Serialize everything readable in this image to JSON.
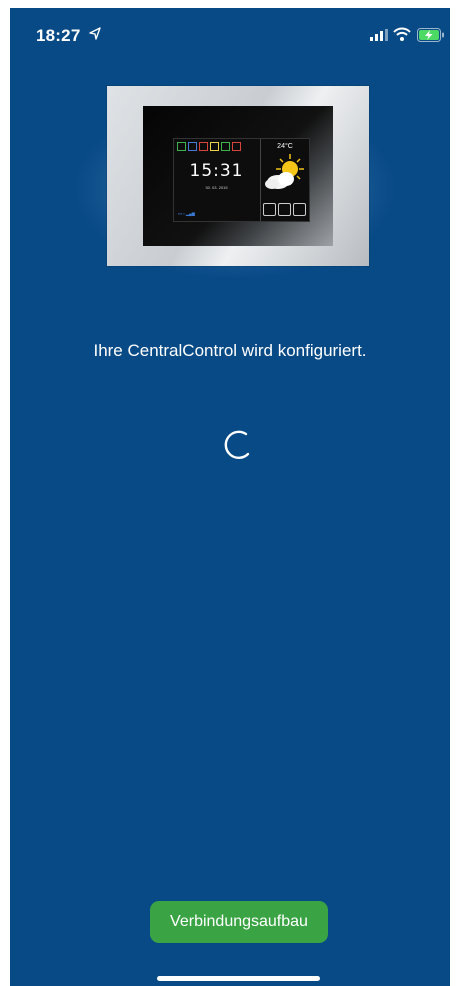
{
  "status_bar": {
    "time": "18:27",
    "location_icon": "location-arrow-icon",
    "signal_icon": "cellular-signal-icon",
    "wifi_icon": "wifi-icon",
    "battery_icon": "battery-charging-icon"
  },
  "device_image": {
    "time": "15:31",
    "date": "30. 03. 2015",
    "temperature": "24°C",
    "weather_icon": "sun-cloud-icon"
  },
  "message": "Ihre CentralControl wird konfiguriert.",
  "spinner_icon": "loading-spinner-icon",
  "button": {
    "label": "Verbindungsaufbau"
  },
  "colors": {
    "background": "#084a86",
    "button": "#3aa344",
    "text": "#ffffff"
  }
}
